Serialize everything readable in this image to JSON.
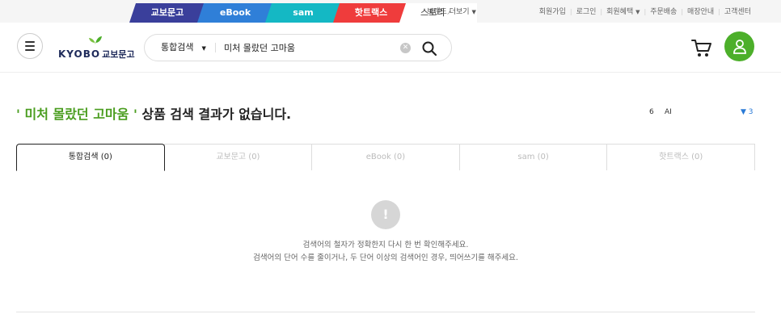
{
  "brand_tabs": {
    "kyobo": "교보문고",
    "ebook": "eBook",
    "sam": "sam",
    "hottracks": "핫트랙스",
    "story": "스토리"
  },
  "brand_more": "브랜드 더보기",
  "util_links": [
    "회원가입",
    "로그인",
    "회원혜택",
    "주문배송",
    "매장안내",
    "고객센터"
  ],
  "util_dropdown_index": 2,
  "logo": {
    "wordmark": "KYOBO",
    "korean": "교보문고"
  },
  "search": {
    "scope": "통합검색",
    "query": "미처 몰랐던 고마움",
    "clear_icon": "clear-icon",
    "search_icon": "search-icon"
  },
  "header_icons": {
    "menu": "hamburger-menu-icon",
    "cart": "cart-icon",
    "user": "user-icon"
  },
  "result": {
    "quote_open": "' ",
    "keyword": "미처 몰랐던 고마움",
    "quote_close": " '",
    "message": " 상품 검색 결과가 없습니다.",
    "count": "6",
    "ai": "AI",
    "page": "▼ 3"
  },
  "tabs": [
    {
      "label": "통합검색 (0)",
      "active": true
    },
    {
      "label": "교보문고 (0)",
      "active": false
    },
    {
      "label": "eBook (0)",
      "active": false
    },
    {
      "label": "sam (0)",
      "active": false
    },
    {
      "label": "핫트랙스 (0)",
      "active": false
    }
  ],
  "empty": {
    "icon": "!",
    "line1": "검색어의 철자가 정확한지 다시 한 번 확인해주세요.",
    "line2": "검색어의 단어 수를 줄이거나, 두 단어 이상의 검색어인 경우, 띄어쓰기를 해주세요."
  },
  "colors": {
    "kyobo": "#3a3f9b",
    "ebook": "#2f7fd8",
    "sam": "#14b8c4",
    "hottracks": "#ef3c3c",
    "keyword": "#4a9d1f",
    "user_button": "#4caf2a"
  }
}
